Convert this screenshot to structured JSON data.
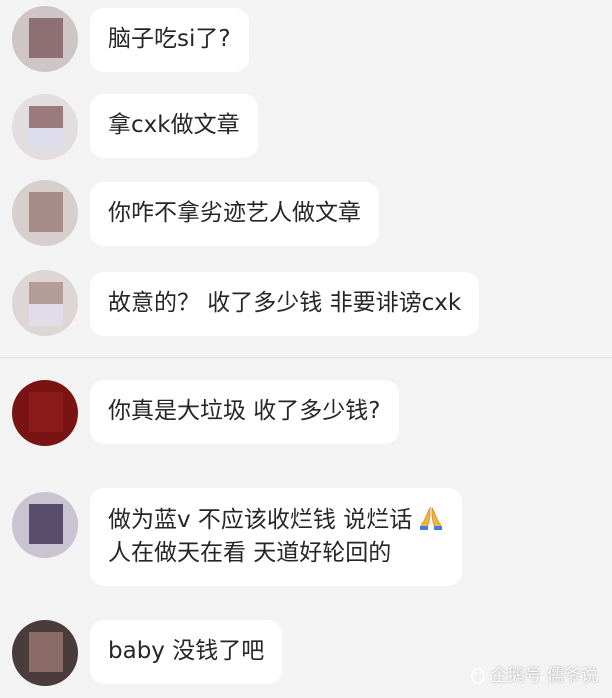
{
  "messages": [
    {
      "text": "脑子吃si了?",
      "avatar_color": "#8e6f74"
    },
    {
      "text": "拿cxk做文章",
      "avatar_color": "#9a7a7f"
    },
    {
      "text": "你咋不拿劣迹艺人做文章",
      "avatar_color": "#a88c8a"
    },
    {
      "text": "故意的？ 收了多少钱 非要诽谤cxk",
      "avatar_color": "#b39d98"
    },
    {
      "text": "你真是大垃圾 收了多少钱?",
      "avatar_color": "#8b1a1a"
    },
    {
      "lines": [
        "做为蓝v 不应该收烂钱 说烂话",
        "人在做天在看 天道好轮回的"
      ],
      "emoji": "folded-hands-icon",
      "avatar_color": "#5a4e6e"
    },
    {
      "text": "baby 没钱了吧",
      "avatar_color": "#6d5250"
    }
  ],
  "watermark": {
    "text": "企鹅号 儒爷说"
  },
  "colors": {
    "background": "#f3f3f3",
    "bubble": "#ffffff",
    "text": "#262626"
  }
}
